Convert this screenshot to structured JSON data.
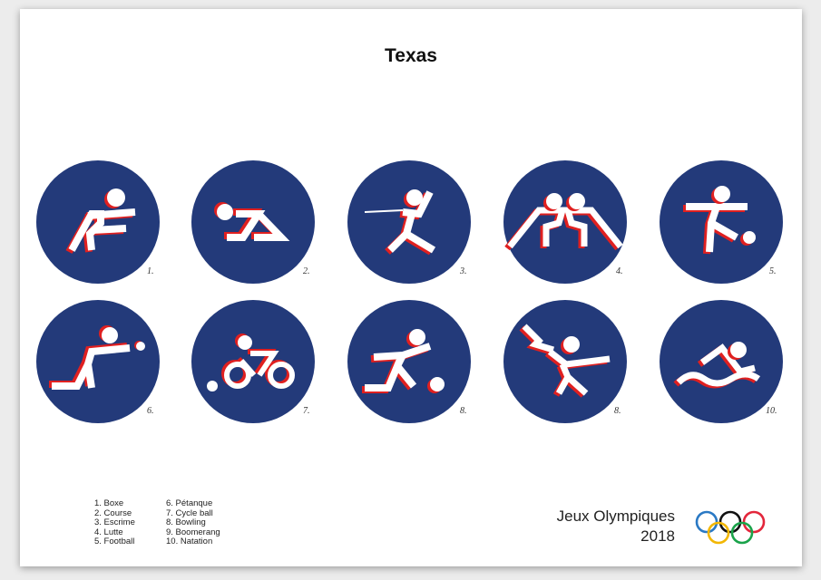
{
  "title": "Texas",
  "pictograms": [
    {
      "number": "1.",
      "sport": "boxe"
    },
    {
      "number": "2.",
      "sport": "course"
    },
    {
      "number": "3.",
      "sport": "escrime"
    },
    {
      "number": "4.",
      "sport": "lutte"
    },
    {
      "number": "5.",
      "sport": "football"
    },
    {
      "number": "6.",
      "sport": "petanque"
    },
    {
      "number": "7.",
      "sport": "cycle-ball"
    },
    {
      "number": "8.",
      "sport": "bowling"
    },
    {
      "number": "8.",
      "sport": "boomerang"
    },
    {
      "number": "10.",
      "sport": "natation"
    }
  ],
  "legend": {
    "col1": [
      "1. Boxe",
      "2. Course",
      "3. Escrime",
      "4. Lutte",
      "5. Football"
    ],
    "col2": [
      "6. Pétanque",
      "7. Cycle ball",
      "8. Bowling",
      "9. Boomerang",
      "10. Natation"
    ]
  },
  "footer": {
    "games": "Jeux Olympiques",
    "year": "2018"
  },
  "colors": {
    "circle": "#233a7a",
    "shadow_red": "#e02020",
    "figure": "#ffffff",
    "rings": [
      "#2a79c4",
      "#f2b705",
      "#111111",
      "#1aa34a",
      "#e3263b"
    ]
  }
}
